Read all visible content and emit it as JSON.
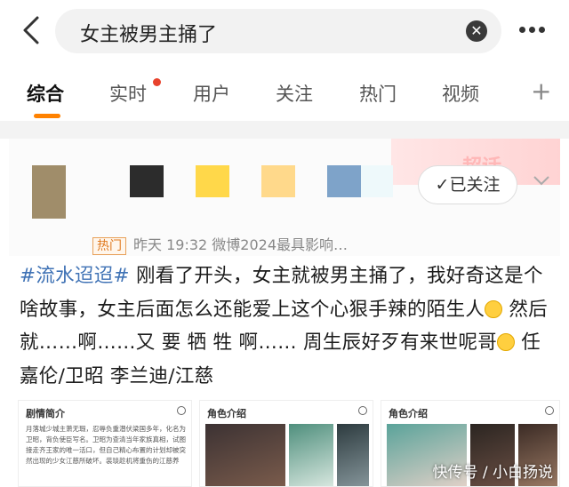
{
  "search": {
    "query": "女主被男主捅了",
    "clear_icon": "clear-icon"
  },
  "tabs": [
    {
      "label": "综合",
      "active": true
    },
    {
      "label": "实时",
      "badge": true
    },
    {
      "label": "用户"
    },
    {
      "label": "关注"
    },
    {
      "label": "热门"
    },
    {
      "label": "视频"
    }
  ],
  "post": {
    "banner_text": "超话",
    "follow_label": "✓已关注",
    "hot_badge": "热门",
    "meta": "昨天 19:32  微博2024最具影响…",
    "hashtag": "#流水迢迢#",
    "text_1": " 刚看了开头，女主就被男主捅了，我好奇这是个啥故事，女主后面怎么还能爱上这个心狠手辣的陌生人",
    "text_2": " 然后就……啊……又 要 牺 牲 啊…… 周生辰好歹有来世呢哥",
    "text_3": " 任嘉伦/卫昭 李兰迪/江慈"
  },
  "cards": [
    {
      "title": "剧情简介",
      "body": "月落城少城主萧无瑕，忍辱负重潜伏梁国多年，化名为卫昭，背负使臣写名。卫昭为查清当年家族真相，试图接走齐王家的唯一活口，但自己精心布置的计划却被突然出现的少女江慈所破坏。装琰趁机将重伤的江慈养"
    },
    {
      "title": "角色介绍"
    },
    {
      "title": "角色介绍"
    }
  ],
  "watermark": "快传号 / 小白扬说",
  "colors": {
    "accent": "#ff8200",
    "hashtag": "#3f72b5"
  }
}
